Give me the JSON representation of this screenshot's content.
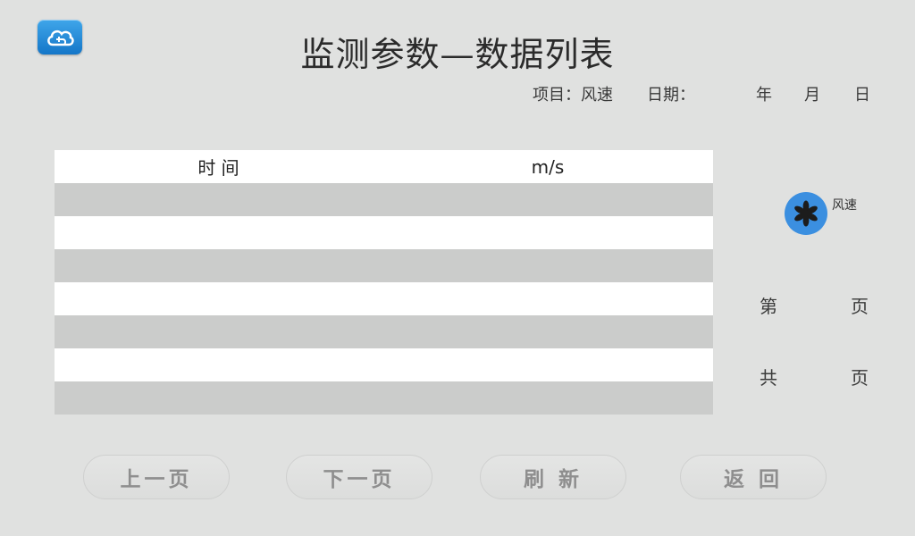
{
  "header": {
    "title": "监测参数—数据列表",
    "project": "项目：风速",
    "date_label": "日期：",
    "year": "年",
    "month": "月",
    "day": "日",
    "app_icon": "cloud-plug-icon"
  },
  "table": {
    "headers": [
      "时 间",
      "m/s"
    ],
    "rows": [
      [
        "",
        ""
      ],
      [
        "",
        ""
      ],
      [
        "",
        ""
      ],
      [
        "",
        ""
      ],
      [
        "",
        ""
      ],
      [
        "",
        ""
      ],
      [
        "",
        ""
      ]
    ]
  },
  "parameter": {
    "icon": "fan-icon",
    "label": "风速",
    "color": "#3b8fe0"
  },
  "pagination": {
    "current_prefix": "第",
    "current_suffix": "页",
    "total_prefix": "共",
    "total_suffix": "页"
  },
  "buttons": {
    "prev": "上一页",
    "next": "下一页",
    "refresh": "刷 新",
    "back": "返 回"
  }
}
